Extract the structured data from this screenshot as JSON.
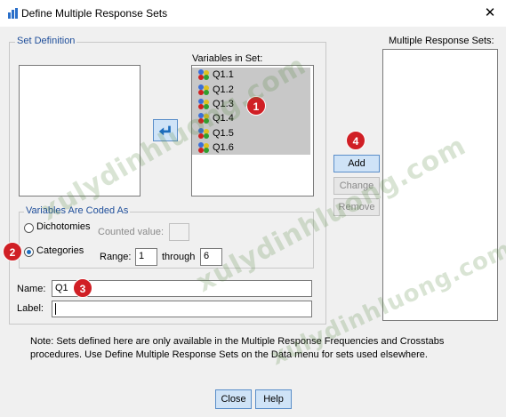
{
  "window": {
    "title": "Define Multiple Response Sets",
    "close_glyph": "✕"
  },
  "set_definition": {
    "legend": "Set Definition",
    "variables_in_set_label": "Variables in Set:",
    "variables_in_set": [
      "Q1.1",
      "Q1.2",
      "Q1.3",
      "Q1.4",
      "Q1.5",
      "Q1.6"
    ],
    "move_button_glyph": "↲"
  },
  "coded_as": {
    "legend": "Variables Are Coded As",
    "dichotomies_label": "Dichotomies",
    "counted_value_label": "Counted value:",
    "counted_value": "",
    "categories_label": "Categories",
    "categories_selected": true,
    "range_label": "Range:",
    "range_from": "1",
    "through_label": "through",
    "range_to": "6"
  },
  "name_field": {
    "label": "Name:",
    "value": "Q1"
  },
  "label_field": {
    "label": "Label:",
    "value": ""
  },
  "multiple_response_sets_label": "Multiple Response Sets:",
  "buttons": {
    "add": "Add",
    "change": "Change",
    "remove": "Remove",
    "close": "Close",
    "help": "Help"
  },
  "note": "Note: Sets defined here are only available in the Multiple Response Frequencies and Crosstabs procedures. Use Define Multiple Response Sets on the Data menu for sets used elsewhere.",
  "badges": [
    "1",
    "2",
    "3",
    "4"
  ],
  "watermark": "xulydinhluong.com",
  "colors": {
    "accent": "#1c6cbd",
    "badge": "#d01f25",
    "selection": "#c8c8c8"
  }
}
